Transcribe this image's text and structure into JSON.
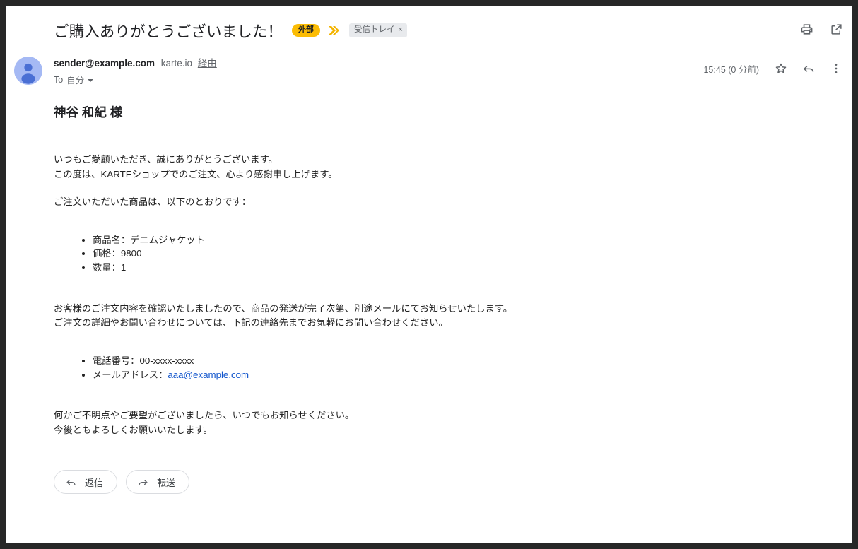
{
  "email": {
    "subject": "ご購入ありがとうございました！",
    "external_badge": "外部",
    "importance_icon": "double-chevron-icon",
    "label_chip": {
      "text": "受信トレイ",
      "remove": "×"
    },
    "top_actions": [
      {
        "name": "print-icon",
        "label": "印刷"
      },
      {
        "name": "open-in-new-window-icon",
        "label": "新しいウィンドウで開く"
      }
    ],
    "sender": {
      "address": "sender@example.com",
      "via_domain": "karte.io",
      "via_label": "経由",
      "to_prefix": "To",
      "to_value": "自分"
    },
    "meta": {
      "timestamp": "15:45 (0 分前)",
      "star_icon": "star-outline-icon",
      "reply_icon": "reply-arrow-icon",
      "more_icon": "more-vertical-icon"
    },
    "avatar_icon": "person-avatar-icon",
    "body": {
      "greeting": "神谷 和紀 様",
      "intro_line_1": "いつもご愛顧いただき、誠にありがとうございます。",
      "intro_line_2": "この度は、KARTEショップでのご注文、心より感謝申し上げます。",
      "order_intro": "ご注文いただいた商品は、以下のとおりです：",
      "order_items": [
        "商品名：デニムジャケット",
        "価格：9800",
        "数量：1"
      ],
      "shipping_line_1": "お客様のご注文内容を確認いたしましたので、商品の発送が完了次第、別途メールにてお知らせいたします。",
      "shipping_line_2": "ご注文の詳細やお問い合わせについては、下記の連絡先までお気軽にお問い合わせください。",
      "contact_items": [
        {
          "label": "電話番号：",
          "value": "00-xxxx-xxxx",
          "is_link": false
        },
        {
          "label": "メールアドレス：",
          "value": "aaa@example.com",
          "is_link": true
        }
      ],
      "closing_line_1": "何かご不明点やご要望がございましたら、いつでもお知らせください。",
      "closing_line_2": "今後ともよろしくお願いいたします。"
    },
    "footer": {
      "reply_button": "返信",
      "forward_button": "転送"
    }
  },
  "colors": {
    "external_badge_bg": "#fbbc04",
    "importance_chevron": "#f4b400",
    "chip_bg": "#e8eaed",
    "link": "#1155cc",
    "avatar_bg": "#a5b9f4",
    "avatar_fg": "#4a6fd4",
    "text_primary": "#202124",
    "text_secondary": "#5f6368",
    "window_frame": "#272727"
  }
}
